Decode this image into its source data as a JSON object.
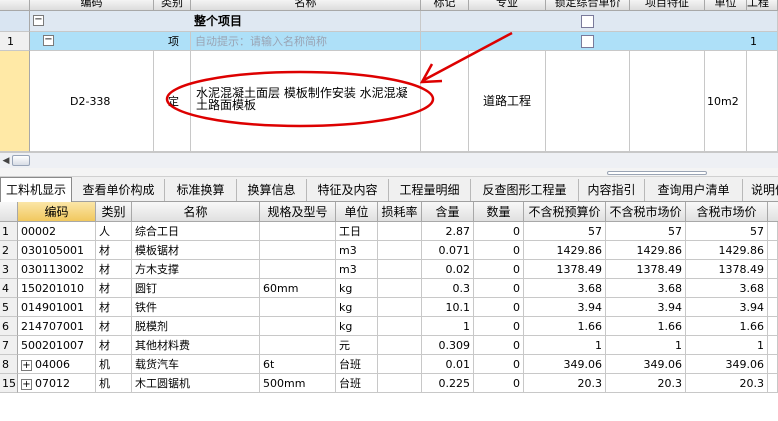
{
  "upper": {
    "headers": [
      "编码",
      "类别",
      "名称",
      "标记",
      "专业",
      "锁定综合单价",
      "项目特征",
      "单位",
      "工程"
    ],
    "root": {
      "name": "整个项目"
    },
    "item1": {
      "rowno": "1",
      "category": "项",
      "hint": "自动提示：请输入名称简称"
    },
    "item2": {
      "code": "D2-338",
      "category": "定",
      "name_line1": "水泥混凝土面层 模板制作安装 水泥混凝",
      "name_line2": "土路面模板",
      "specialty": "道路工程",
      "unit": "10m2"
    },
    "item1_qty": "1"
  },
  "tabs": [
    "工料机显示",
    "查看单价构成",
    "标准换算",
    "换算信息",
    "特征及内容",
    "工程量明细",
    "反查图形工程量",
    "内容指引",
    "查询用户清单",
    "说明信"
  ],
  "lower": {
    "headers": [
      "编码",
      "类别",
      "名称",
      "规格及型号",
      "单位",
      "损耗率",
      "含量",
      "数量",
      "不含税预算价",
      "不含税市场价",
      "含税市场价"
    ],
    "rows": [
      {
        "no": "1",
        "code": "00002",
        "cat": "人",
        "name": "综合工日",
        "spec": "",
        "unit": "工日",
        "loss": "",
        "content": "2.87",
        "qty": "0",
        "budget": "57",
        "market": "57",
        "taxmarket": "57",
        "expand": false
      },
      {
        "no": "2",
        "code": "030105001",
        "cat": "材",
        "name": "模板锯材",
        "spec": "",
        "unit": "m3",
        "loss": "",
        "content": "0.071",
        "qty": "0",
        "budget": "1429.86",
        "market": "1429.86",
        "taxmarket": "1429.86",
        "expand": false
      },
      {
        "no": "3",
        "code": "030113002",
        "cat": "材",
        "name": "方木支撑",
        "spec": "",
        "unit": "m3",
        "loss": "",
        "content": "0.02",
        "qty": "0",
        "budget": "1378.49",
        "market": "1378.49",
        "taxmarket": "1378.49",
        "expand": false
      },
      {
        "no": "4",
        "code": "150201010",
        "cat": "材",
        "name": "圆钉",
        "spec": "60mm",
        "unit": "kg",
        "loss": "",
        "content": "0.3",
        "qty": "0",
        "budget": "3.68",
        "market": "3.68",
        "taxmarket": "3.68",
        "expand": false
      },
      {
        "no": "5",
        "code": "014901001",
        "cat": "材",
        "name": "铁件",
        "spec": "",
        "unit": "kg",
        "loss": "",
        "content": "10.1",
        "qty": "0",
        "budget": "3.94",
        "market": "3.94",
        "taxmarket": "3.94",
        "expand": false
      },
      {
        "no": "6",
        "code": "214707001",
        "cat": "材",
        "name": "脱模剂",
        "spec": "",
        "unit": "kg",
        "loss": "",
        "content": "1",
        "qty": "0",
        "budget": "1.66",
        "market": "1.66",
        "taxmarket": "1.66",
        "expand": false
      },
      {
        "no": "7",
        "code": "500201007",
        "cat": "材",
        "name": "其他材料费",
        "spec": "",
        "unit": "元",
        "loss": "",
        "content": "0.309",
        "qty": "0",
        "budget": "1",
        "market": "1",
        "taxmarket": "1",
        "expand": false
      },
      {
        "no": "8",
        "code": "04006",
        "cat": "机",
        "name": "载货汽车",
        "spec": "6t",
        "unit": "台班",
        "loss": "",
        "content": "0.01",
        "qty": "0",
        "budget": "349.06",
        "market": "349.06",
        "taxmarket": "349.06",
        "expand": true
      },
      {
        "no": "15",
        "code": "07012",
        "cat": "机",
        "name": "木工圆锯机",
        "spec": "500mm",
        "unit": "台班",
        "loss": "",
        "content": "0.225",
        "qty": "0",
        "budget": "20.3",
        "market": "20.3",
        "taxmarket": "20.3",
        "expand": true
      }
    ]
  },
  "colors": {
    "selected_row": "#d0e4f8",
    "highlight_row": "#ffe9a6",
    "annotation": "#dd0000",
    "header_selected": "#f1c85e"
  },
  "icons": [
    "collapse-icon",
    "checkbox-icon",
    "expand-icon",
    "scroll-left-icon"
  ]
}
